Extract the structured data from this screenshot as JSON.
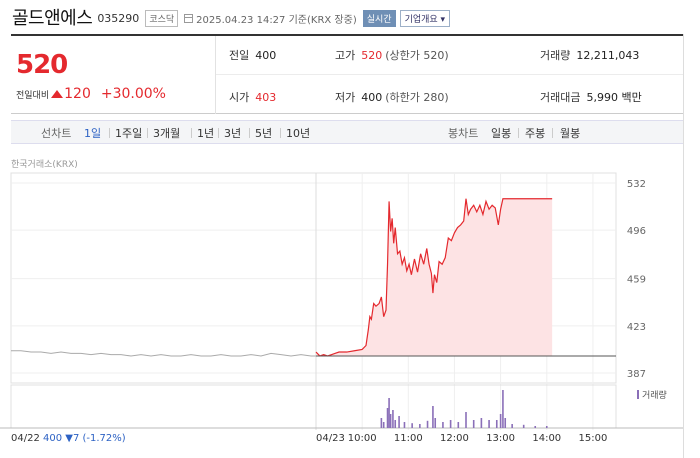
{
  "header": {
    "stock_name": "골드앤에스",
    "stock_code": "035290",
    "market": "코스닥",
    "date_text": "2025.04.23 14:27 기준(KRX 장중)",
    "realtime_label": "실시간",
    "corp_label": "기업개요 ▾"
  },
  "quote": {
    "price": "520",
    "change_label": "전일대비",
    "change_value": "120",
    "change_pct": "+30.00%",
    "prev_label": "전일",
    "prev_value": "400",
    "open_label": "시가",
    "open_value": "403",
    "high_label": "고가",
    "high_value": "520",
    "high_limit": "(상한가 520)",
    "low_label": "저가",
    "low_value": "400",
    "low_limit": "(하한가 280)",
    "volume_label": "거래량",
    "volume_value": "12,211,043",
    "amount_label": "거래대금",
    "amount_value": "5,990 백만"
  },
  "period_bar": {
    "line_chart_label": "선차트",
    "periods": [
      "1일",
      "1주일",
      "3개월",
      "1년",
      "3년",
      "5년",
      "10년"
    ],
    "candle_label": "봉차트",
    "candles": [
      "일봉",
      "주봉",
      "월봉"
    ]
  },
  "chart_source": "한국거래소(KRX)",
  "colors": {
    "up": "#e4292e",
    "down": "#2d62c4",
    "fill": "#fde3e4",
    "volume": "#8a6fb8"
  },
  "chart_data": {
    "type": "line",
    "y_ticks": [
      "532",
      "496",
      "459",
      "423",
      "387"
    ],
    "ylim": [
      387,
      532
    ],
    "x_ticks": [
      "10:00",
      "11:00",
      "12:00",
      "13:00",
      "14:00",
      "15:00"
    ],
    "prev_date": "04/22",
    "today_date": "04/23",
    "prev_close_note": "400 ▼7 (-1.72%)",
    "volume_legend": "거래량",
    "prev_day_series": [
      [
        0,
        404
      ],
      [
        10,
        404
      ],
      [
        20,
        403
      ],
      [
        30,
        403
      ],
      [
        40,
        402
      ],
      [
        50,
        403
      ],
      [
        60,
        402
      ],
      [
        70,
        402
      ],
      [
        80,
        401
      ],
      [
        90,
        402
      ],
      [
        100,
        401
      ],
      [
        110,
        401
      ],
      [
        120,
        400
      ],
      [
        130,
        401
      ],
      [
        140,
        400
      ],
      [
        150,
        401
      ],
      [
        160,
        400
      ],
      [
        170,
        400
      ],
      [
        180,
        401
      ],
      [
        190,
        400
      ],
      [
        200,
        400
      ],
      [
        210,
        401
      ],
      [
        220,
        400
      ],
      [
        230,
        400
      ],
      [
        240,
        401
      ],
      [
        250,
        400
      ],
      [
        260,
        402
      ],
      [
        270,
        401
      ],
      [
        280,
        400
      ],
      [
        290,
        401
      ],
      [
        300,
        400
      ],
      [
        306,
        400
      ]
    ],
    "today_series": [
      [
        "09:00",
        403
      ],
      [
        "09:05",
        400
      ],
      [
        "09:10",
        401
      ],
      [
        "09:15",
        400
      ],
      [
        "09:20",
        401
      ],
      [
        "09:25",
        402
      ],
      [
        "09:30",
        403
      ],
      [
        "09:40",
        403
      ],
      [
        "09:50",
        404
      ],
      [
        "10:00",
        405
      ],
      [
        "10:05",
        408
      ],
      [
        "10:08",
        420
      ],
      [
        "10:10",
        430
      ],
      [
        "10:12",
        428
      ],
      [
        "10:15",
        440
      ],
      [
        "10:18",
        438
      ],
      [
        "10:22",
        440
      ],
      [
        "10:25",
        445
      ],
      [
        "10:28",
        430
      ],
      [
        "10:31",
        435
      ],
      [
        "10:33",
        470
      ],
      [
        "10:35",
        518
      ],
      [
        "10:37",
        495
      ],
      [
        "10:39",
        505
      ],
      [
        "10:41",
        486
      ],
      [
        "10:43",
        498
      ],
      [
        "10:46",
        478
      ],
      [
        "10:49",
        480
      ],
      [
        "10:52",
        470
      ],
      [
        "10:55",
        475
      ],
      [
        "10:58",
        465
      ],
      [
        "11:01",
        470
      ],
      [
        "11:04",
        462
      ],
      [
        "11:08",
        474
      ],
      [
        "11:12",
        464
      ],
      [
        "11:16",
        478
      ],
      [
        "11:20",
        470
      ],
      [
        "11:24",
        482
      ],
      [
        "11:27",
        470
      ],
      [
        "11:30",
        463
      ],
      [
        "11:32",
        448
      ],
      [
        "11:34",
        462
      ],
      [
        "11:37",
        456
      ],
      [
        "11:40",
        472
      ],
      [
        "11:44",
        470
      ],
      [
        "11:48",
        475
      ],
      [
        "11:52",
        490
      ],
      [
        "11:56",
        488
      ],
      [
        "12:00",
        494
      ],
      [
        "12:04",
        498
      ],
      [
        "12:08",
        500
      ],
      [
        "12:12",
        503
      ],
      [
        "12:15",
        520
      ],
      [
        "12:18",
        508
      ],
      [
        "12:21",
        512
      ],
      [
        "12:25",
        515
      ],
      [
        "12:29",
        510
      ],
      [
        "12:33",
        515
      ],
      [
        "12:37",
        508
      ],
      [
        "12:41",
        518
      ],
      [
        "12:45",
        512
      ],
      [
        "12:49",
        515
      ],
      [
        "12:53",
        513
      ],
      [
        "12:57",
        500
      ],
      [
        "13:00",
        512
      ],
      [
        "13:03",
        520
      ],
      [
        "13:06",
        520
      ],
      [
        "13:10",
        520
      ],
      [
        "13:20",
        520
      ],
      [
        "13:40",
        520
      ],
      [
        "14:00",
        520
      ],
      [
        "14:07",
        520
      ]
    ],
    "prev_close": 400,
    "volume_bars": [
      [
        "10:25",
        0.25
      ],
      [
        "10:28",
        0.15
      ],
      [
        "10:33",
        0.5
      ],
      [
        "10:35",
        0.75
      ],
      [
        "10:37",
        0.35
      ],
      [
        "10:40",
        0.45
      ],
      [
        "10:43",
        0.2
      ],
      [
        "10:48",
        0.3
      ],
      [
        "10:55",
        0.15
      ],
      [
        "11:05",
        0.12
      ],
      [
        "11:15",
        0.1
      ],
      [
        "11:25",
        0.18
      ],
      [
        "11:32",
        0.55
      ],
      [
        "11:35",
        0.25
      ],
      [
        "11:45",
        0.15
      ],
      [
        "11:55",
        0.2
      ],
      [
        "12:05",
        0.15
      ],
      [
        "12:15",
        0.4
      ],
      [
        "12:25",
        0.2
      ],
      [
        "12:35",
        0.25
      ],
      [
        "12:45",
        0.2
      ],
      [
        "12:55",
        0.2
      ],
      [
        "13:00",
        0.35
      ],
      [
        "13:03",
        0.95
      ],
      [
        "13:06",
        0.25
      ],
      [
        "13:15",
        0.1
      ],
      [
        "13:30",
        0.08
      ],
      [
        "13:45",
        0.05
      ],
      [
        "14:00",
        0.05
      ]
    ]
  }
}
